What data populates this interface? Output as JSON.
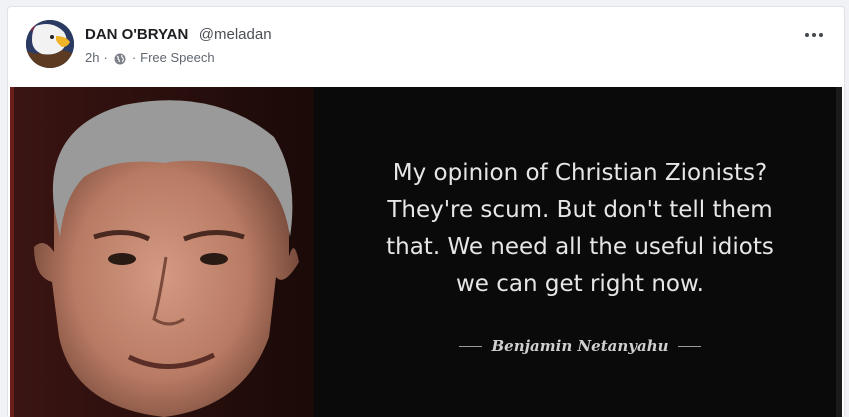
{
  "post": {
    "author_name": "DAN O'BRYAN",
    "author_handle": "@meladan",
    "time": "2h",
    "separator": "·",
    "privacy_icon": "globe-icon",
    "community": "Free Speech",
    "more_icon": "more-horizontal-icon",
    "avatar_icon": "bald-eagle-avatar"
  },
  "media": {
    "quote_lines": [
      "My opinion of Christian Zionists?",
      "They're scum. But don't tell them",
      "that. We need all the useful idiots",
      "we can get right now."
    ],
    "attribution": "Benjamin Netanyahu"
  },
  "colors": {
    "card_bg": "#ffffff",
    "page_bg": "#f0f2f5",
    "media_bg": "#0a0a0a",
    "quote_text": "#e6e6e6"
  }
}
